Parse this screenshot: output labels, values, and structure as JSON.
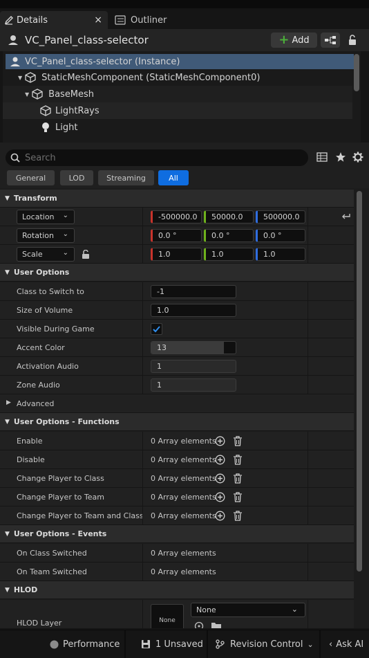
{
  "tabs": [
    {
      "label": "Details",
      "close": "×"
    },
    {
      "label": "Outliner"
    }
  ],
  "header": {
    "title": "VC_Panel_class-selector",
    "add_label": "Add"
  },
  "tree": [
    {
      "label": "VC_Panel_class-selector (Instance)",
      "icon": "actor-icon"
    },
    {
      "label": "StaticMeshComponent (StaticMeshComponent0)",
      "icon": "cube-icon"
    },
    {
      "label": "BaseMesh",
      "icon": "cube-icon"
    },
    {
      "label": "LightRays",
      "icon": "cube-icon"
    },
    {
      "label": "Light",
      "icon": "bulb-icon"
    }
  ],
  "search": {
    "placeholder": "Search"
  },
  "filters": [
    "General",
    "LOD",
    "Streaming",
    "All"
  ],
  "transform": {
    "section": "Transform",
    "location_label": "Location",
    "location": [
      "-500000.0",
      "50000.0",
      "500000.0"
    ],
    "rotation_label": "Rotation",
    "rotation": [
      "0.0 °",
      "0.0 °",
      "0.0 °"
    ],
    "scale_label": "Scale",
    "scale": [
      "1.0",
      "1.0",
      "1.0"
    ]
  },
  "user_options": {
    "section": "User Options",
    "class_to_switch_label": "Class to Switch to",
    "class_to_switch_value": "-1",
    "size_label": "Size of Volume",
    "size_value": "1.0",
    "visible_label": "Visible During Game",
    "visible_checked": true,
    "accent_label": "Accent Color",
    "accent_value": "13",
    "accent_fill": 0.86,
    "activation_label": "Activation Audio",
    "activation_value": "1",
    "zone_label": "Zone Audio",
    "zone_value": "1",
    "advanced_label": "Advanced"
  },
  "functions": {
    "section": "User Options - Functions",
    "rows": [
      {
        "label": "Enable",
        "value": "0 Array elements"
      },
      {
        "label": "Disable",
        "value": "0 Array elements"
      },
      {
        "label": "Change Player to Class",
        "value": "0 Array elements"
      },
      {
        "label": "Change Player to Team",
        "value": "0 Array elements"
      },
      {
        "label": "Change Player to Team and Class",
        "value": "0 Array elements"
      }
    ]
  },
  "events": {
    "section": "User Options - Events",
    "rows": [
      {
        "label": "On Class Switched",
        "value": "0 Array elements"
      },
      {
        "label": "On Team Switched",
        "value": "0 Array elements"
      }
    ]
  },
  "hlod": {
    "section": "HLOD",
    "layer_label": "HLOD Layer",
    "thumb_label": "None",
    "dropdown_value": "None"
  },
  "statusbar": {
    "performance": "Performance",
    "unsaved": "1 Unsaved",
    "revision": "Revision Control",
    "ask_ai": "Ask AI"
  },
  "colors": {
    "accent_blue": "#0f6de0",
    "axis_x": "#c8332b",
    "axis_y": "#6fb21c",
    "axis_z": "#2f6de0",
    "add_plus": "#4caf3a"
  }
}
